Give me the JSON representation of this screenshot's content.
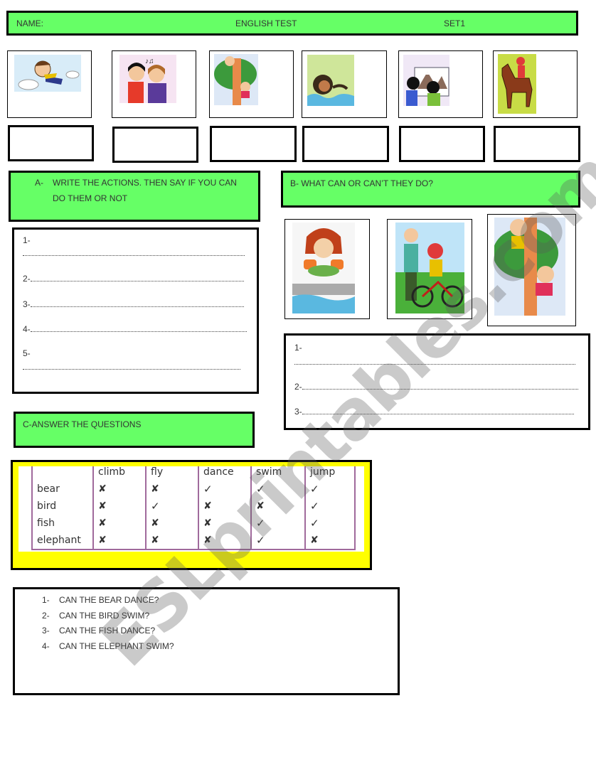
{
  "header": {
    "name_label": "NAME:",
    "title": "ENGLISH TEST",
    "set": "SET1",
    "bg_color": "#66ff66"
  },
  "top_pictures": [
    {
      "icon": "boy-flying-icon",
      "action": "fly"
    },
    {
      "icon": "girls-singing-icon",
      "action": "sing"
    },
    {
      "icon": "kids-climbing-tree-icon",
      "action": "climb"
    },
    {
      "icon": "girl-swimming-icon",
      "action": "swim"
    },
    {
      "icon": "kids-painting-icon",
      "action": "paint"
    },
    {
      "icon": "girl-riding-horse-icon",
      "action": "ride a horse"
    }
  ],
  "section_a": {
    "marker": "A-",
    "title_line1": "WRITE THE ACTIONS. THEN SAY IF YOU CAN",
    "title_line2": "DO THEM OR NOT",
    "lines": [
      "1-",
      "",
      "2-",
      "3-",
      "4-",
      "5-",
      ""
    ]
  },
  "section_b": {
    "title": "B- WHAT CAN OR CAN’T THEY DO?",
    "pictures": [
      {
        "icon": "girl-with-armbands-icon"
      },
      {
        "icon": "boy-riding-bike-icon"
      },
      {
        "icon": "kids-climbing-tree-icon"
      }
    ],
    "lines": [
      "1-",
      "",
      "2-",
      "3-"
    ]
  },
  "section_c": {
    "title": "C-ANSWER THE QUESTIONS",
    "table": {
      "columns": [
        "",
        "climb",
        "fly",
        "dance",
        "swim",
        "jump"
      ],
      "rows": [
        {
          "animal": "bear",
          "values": [
            "✘",
            "✘",
            "✓",
            "✓",
            "✓"
          ]
        },
        {
          "animal": "bird",
          "values": [
            "✘",
            "✓",
            "✘",
            "✘",
            "✓"
          ]
        },
        {
          "animal": "fish",
          "values": [
            "✘",
            "✘",
            "✘",
            "✓",
            "✓"
          ]
        },
        {
          "animal": "elephant",
          "values": [
            "✘",
            "✘",
            "✘",
            "✓",
            "✘"
          ]
        }
      ]
    },
    "questions": [
      {
        "num": "1-",
        "text": "CAN THE BEAR DANCE?"
      },
      {
        "num": "2-",
        "text": "CAN THE BIRD SWIM?"
      },
      {
        "num": "3-",
        "text": "CAN THE FISH DANCE?"
      },
      {
        "num": "4-",
        "text": "CAN THE ELEPHANT SWIM?"
      }
    ]
  },
  "watermark": "ESLprintables.com"
}
